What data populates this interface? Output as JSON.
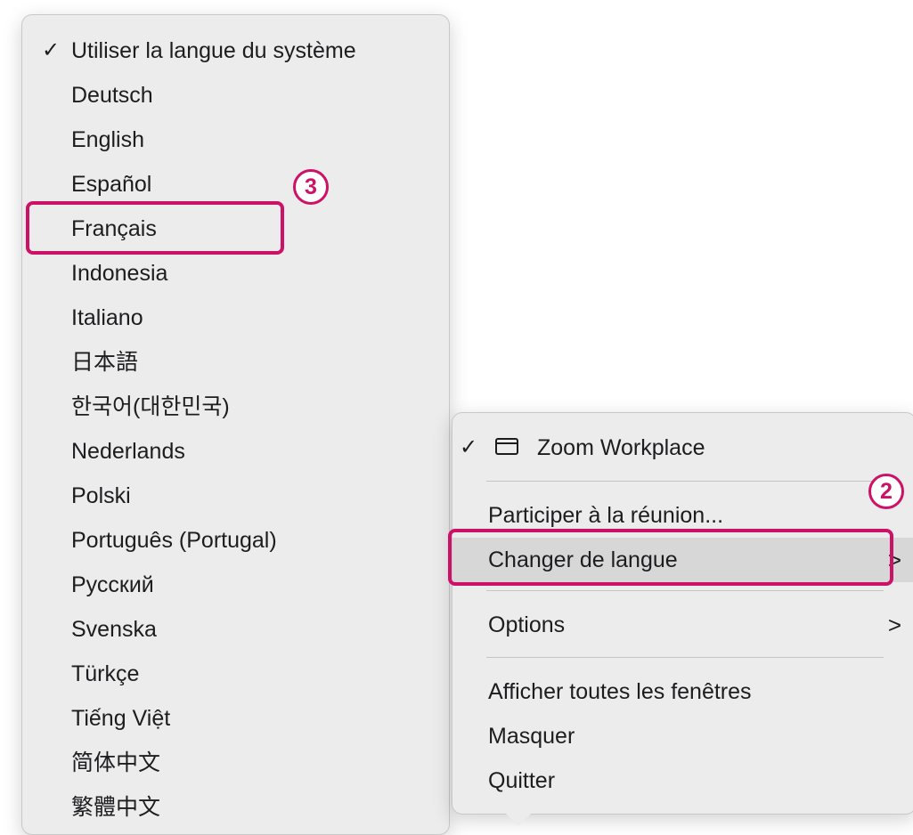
{
  "language_menu": {
    "items": [
      {
        "label": "Utiliser la langue du système",
        "checked": true
      },
      {
        "label": "Deutsch"
      },
      {
        "label": "English"
      },
      {
        "label": "Español"
      },
      {
        "label": "Français",
        "highlighted": true
      },
      {
        "label": "Indonesia"
      },
      {
        "label": "Italiano"
      },
      {
        "label": "日本語"
      },
      {
        "label": "한국어(대한민국)"
      },
      {
        "label": "Nederlands"
      },
      {
        "label": "Polski"
      },
      {
        "label": "Português (Portugal)"
      },
      {
        "label": "Русский"
      },
      {
        "label": "Svenska"
      },
      {
        "label": "Türkçe"
      },
      {
        "label": "Tiếng Việt"
      },
      {
        "label": "简体中文"
      },
      {
        "label": "繁體中文"
      }
    ]
  },
  "dock_menu": {
    "app_item": {
      "label": "Zoom Workplace",
      "checked": true,
      "icon": "window-icon"
    },
    "join_meeting": "Participer à la réunion...",
    "change_language": "Changer de langue",
    "options": "Options",
    "show_all_windows": "Afficher toutes les fenêtres",
    "hide": "Masquer",
    "quit": "Quitter"
  },
  "glyphs": {
    "check": "✓",
    "chevron": ">"
  },
  "annotations": {
    "step_2": "2",
    "step_3": "3",
    "color": "#cc1166"
  }
}
